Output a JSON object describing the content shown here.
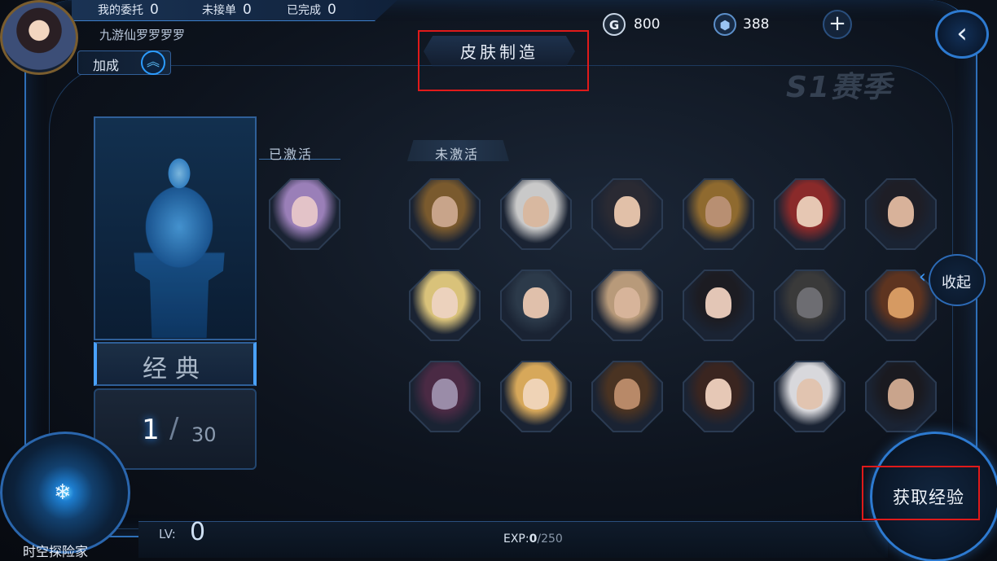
{
  "header": {
    "missions": [
      {
        "label": "我的委托",
        "value": "0"
      },
      {
        "label": "未接单",
        "value": "0"
      },
      {
        "label": "已完成",
        "value": "0"
      }
    ],
    "player_name": "九游仙罗罗罗罗",
    "bonus_label": "加成",
    "title": "皮肤制造",
    "gold": "800",
    "gems": "388",
    "season": "S1赛季"
  },
  "card": {
    "name": "经典",
    "collected": "1",
    "total": "30"
  },
  "tabs": {
    "activated": "已激活",
    "not_activated": "未激活"
  },
  "collapse_label": "收起",
  "footer": {
    "explorer": "时空探险家",
    "lv_label": "LV:",
    "lv_value": "0",
    "exp_label": "EXP:",
    "exp_current": "0",
    "exp_max": "250",
    "gain_exp": "获取经验"
  },
  "skins": {
    "activated": [
      {
        "hair": "#9a7fb8",
        "skin": "#e3c3c8"
      }
    ],
    "not_activated": [
      {
        "hair": "#7a5a2e",
        "skin": "#c8a48a"
      },
      {
        "hair": "#c9c9c9",
        "skin": "#d8b8a0"
      },
      {
        "hair": "#2a2a33",
        "skin": "#e1c0a8"
      },
      {
        "hair": "#8f6a2f",
        "skin": "#b88f72"
      },
      {
        "hair": "#8a2a2a",
        "skin": "#e6c7b3"
      },
      {
        "hair": "#1e1e26",
        "skin": "#d8b29a"
      },
      {
        "hair": "#d9c27a",
        "skin": "#ecd2bd"
      },
      {
        "hair": "#2c3a4a",
        "skin": "#e0c0ab"
      },
      {
        "hair": "#b89a7a",
        "skin": "#d7b49a"
      },
      {
        "hair": "#1c1c22",
        "skin": "#e3c6b6"
      },
      {
        "hair": "#3a3a3a",
        "skin": "#6d6d72"
      },
      {
        "hair": "#5e3420",
        "skin": "#d69a62"
      },
      {
        "hair": "#4a2a44",
        "skin": "#9a8ca8"
      },
      {
        "hair": "#d7a85a",
        "skin": "#efd3b6"
      },
      {
        "hair": "#4a3322",
        "skin": "#b88968"
      },
      {
        "hair": "#3a2520",
        "skin": "#e6c8b6"
      },
      {
        "hair": "#d8d8dc",
        "skin": "#e1c4b0"
      },
      {
        "hair": "#1a1a20",
        "skin": "#c9a48c"
      }
    ]
  }
}
